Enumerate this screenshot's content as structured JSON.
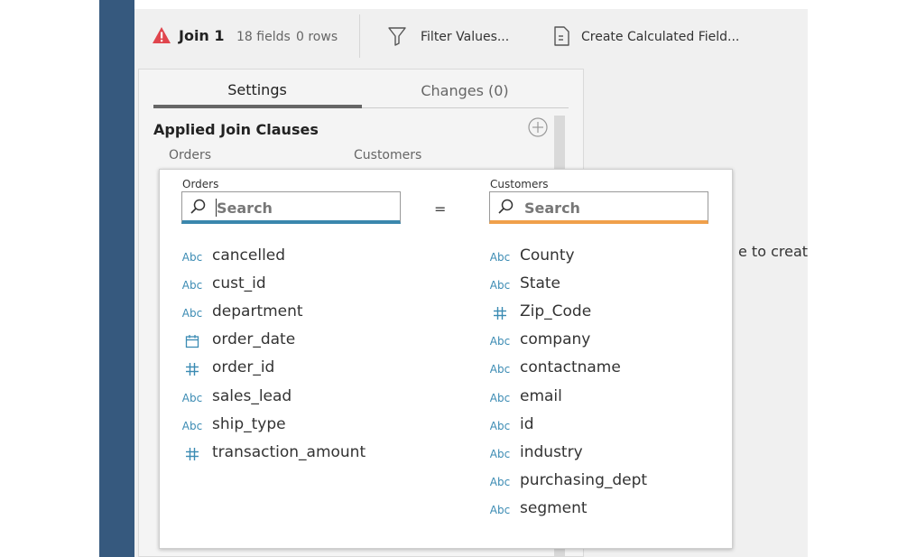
{
  "toolbar": {
    "step_name": "Join 1",
    "fields": "18 fields",
    "rows": "0 rows",
    "filter_label": "Filter Values...",
    "calc_label": "Create Calculated Field..."
  },
  "settings_panel": {
    "tabs": [
      {
        "label": "Settings",
        "active": true
      },
      {
        "label": "Changes (0)",
        "active": false
      }
    ],
    "section_title": "Applied Join Clauses",
    "left_column": "Orders",
    "right_column": "Customers"
  },
  "background_text": "e to creat",
  "join_popup": {
    "left": {
      "label": "Orders",
      "search_placeholder": "Search",
      "fields": [
        {
          "type": "string",
          "type_label": "Abc",
          "name": "cancelled"
        },
        {
          "type": "string",
          "type_label": "Abc",
          "name": "cust_id"
        },
        {
          "type": "string",
          "type_label": "Abc",
          "name": "department"
        },
        {
          "type": "date",
          "type_label": "",
          "name": "order_date"
        },
        {
          "type": "number",
          "type_label": "#",
          "name": "order_id"
        },
        {
          "type": "string",
          "type_label": "Abc",
          "name": "sales_lead"
        },
        {
          "type": "string",
          "type_label": "Abc",
          "name": "ship_type"
        },
        {
          "type": "number",
          "type_label": "#",
          "name": "transaction_amount"
        }
      ]
    },
    "operator": "=",
    "right": {
      "label": "Customers",
      "search_placeholder": "Search",
      "fields": [
        {
          "type": "string",
          "type_label": "Abc",
          "name": "County"
        },
        {
          "type": "string",
          "type_label": "Abc",
          "name": "State"
        },
        {
          "type": "number",
          "type_label": "#",
          "name": "Zip_Code"
        },
        {
          "type": "string",
          "type_label": "Abc",
          "name": "company"
        },
        {
          "type": "string",
          "type_label": "Abc",
          "name": "contactname"
        },
        {
          "type": "string",
          "type_label": "Abc",
          "name": "email"
        },
        {
          "type": "string",
          "type_label": "Abc",
          "name": "id"
        },
        {
          "type": "string",
          "type_label": "Abc",
          "name": "industry"
        },
        {
          "type": "string",
          "type_label": "Abc",
          "name": "purchasing_dept"
        },
        {
          "type": "string",
          "type_label": "Abc",
          "name": "segment"
        }
      ]
    }
  },
  "colors": {
    "sidebar": "#36597e",
    "left_search_accent": "#3a87ad",
    "right_search_accent": "#f0a04b",
    "type_icon": "#3b8bb3",
    "warning": "#e0454d"
  }
}
